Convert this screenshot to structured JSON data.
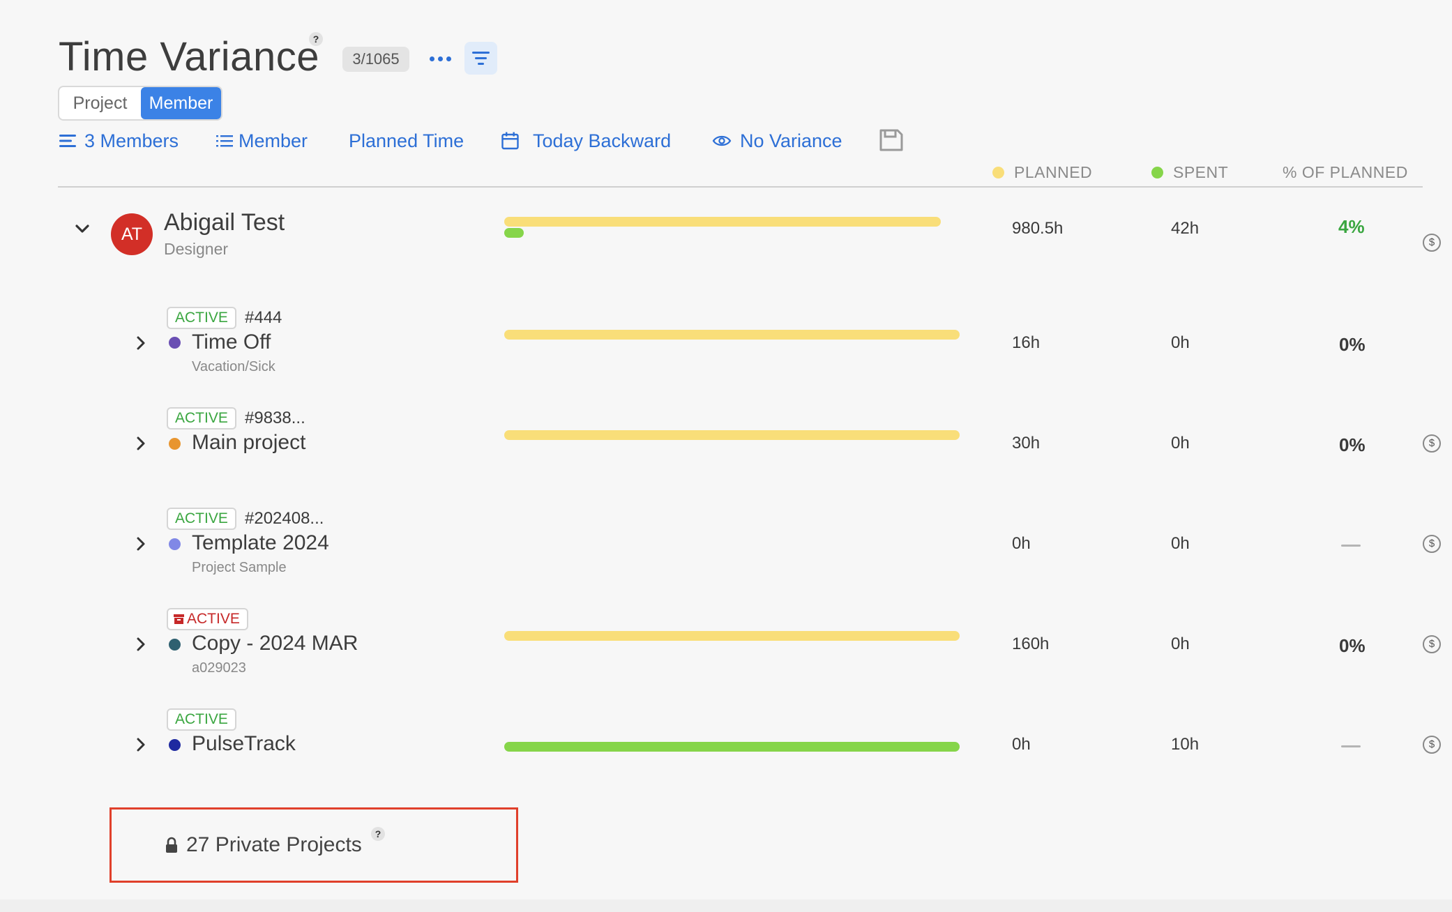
{
  "header": {
    "title": "Time Variance",
    "help_icon": "?",
    "count_badge": "3/1065",
    "more_icon": "more-dots-icon",
    "filter_icon": "filter-icon"
  },
  "view_toggle": {
    "options": [
      "Project",
      "Member"
    ],
    "selected": "Member"
  },
  "toolbar": {
    "members_label": "3 Members",
    "group_label": "Member",
    "metric_label": "Planned Time",
    "date_label": "Today Backward",
    "variance_label": "No Variance",
    "save_icon": "save-icon"
  },
  "columns": {
    "planned": "PLANNED",
    "spent": "SPENT",
    "percent": "% OF PLANNED"
  },
  "colors": {
    "accent": "#2d6fd6",
    "planned": "#f9de79",
    "spent": "#86d54a",
    "active_status": "#3aa640",
    "archived_status": "#c62828",
    "avatar": "#d22f27",
    "highlight_box": "#e0402b"
  },
  "member": {
    "initials": "AT",
    "name": "Abigail Test",
    "role": "Designer",
    "planned": "980.5h",
    "spent": "42h",
    "percent": "4%",
    "planned_hours": 980.5,
    "spent_hours": 42
  },
  "projects": [
    {
      "status": "ACTIVE",
      "archived": false,
      "id": "#444",
      "name": "Time Off",
      "sub": "Vacation/Sick",
      "dot_color": "#6a4fb3",
      "planned": "16h",
      "spent": "0h",
      "percent": "0%",
      "planned_hours": 16,
      "spent_hours": 0
    },
    {
      "status": "ACTIVE",
      "archived": false,
      "id": "#9838...",
      "name": "Main project",
      "sub": "",
      "dot_color": "#e8952f",
      "planned": "30h",
      "spent": "0h",
      "percent": "0%",
      "planned_hours": 30,
      "spent_hours": 0
    },
    {
      "status": "ACTIVE",
      "archived": false,
      "id": "#202408...",
      "name": "Template 2024",
      "sub": "Project Sample",
      "dot_color": "#8088e6",
      "planned": "0h",
      "spent": "0h",
      "percent": "",
      "planned_hours": 0,
      "spent_hours": 0
    },
    {
      "status": "ACTIVE",
      "archived": true,
      "id": "",
      "name": "Copy - 2024 MAR",
      "sub": "a029023",
      "dot_color": "#2f6070",
      "planned": "160h",
      "spent": "0h",
      "percent": "0%",
      "planned_hours": 160,
      "spent_hours": 0
    },
    {
      "status": "ACTIVE",
      "archived": false,
      "id": "",
      "name": "PulseTrack",
      "sub": "",
      "dot_color": "#1f2aa0",
      "planned": "0h",
      "spent": "10h",
      "percent": "",
      "planned_hours": 0,
      "spent_hours": 10
    }
  ],
  "private_projects": {
    "label": "27 Private Projects",
    "help_icon": "?"
  }
}
